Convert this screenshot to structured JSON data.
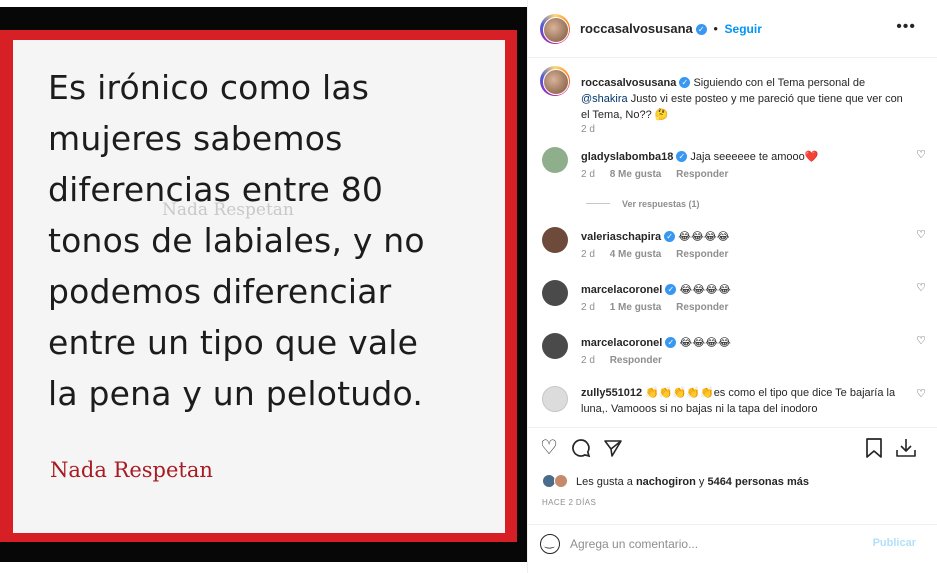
{
  "post_image": {
    "quote_lines": [
      "Es irónico como las",
      "mujeres sabemos",
      "diferencias entre 80",
      "tonos de labiales, y no",
      "podemos diferenciar",
      "entre un tipo que vale",
      "la pena y un pelotudo."
    ],
    "watermark": "Nada Respetan",
    "signature": "Nada Respetan"
  },
  "header": {
    "username": "roccasalvosusana",
    "separator": "•",
    "follow_label": "Seguir",
    "more_icon": "more-options-icon"
  },
  "caption": {
    "username": "roccasalvosusana",
    "text_before": " Siguiendo con el Tema personal de ",
    "mention": "@shakira",
    "text_after": " Justo vi este posteo y me pareció que tiene que ver con el Tema, No?? 🤔",
    "time": "2 d"
  },
  "comments": [
    {
      "username": "gladyslabomba18",
      "verified": true,
      "text": " Jaja seeeeee te amooo❤️",
      "time": "2 d",
      "likes": "8 Me gusta",
      "reply": "Responder",
      "avatar_color": "#8fae8b"
    },
    {
      "username": "valeriaschapira",
      "verified": true,
      "text": " 😂😂😂😂",
      "time": "2 d",
      "likes": "4 Me gusta",
      "reply": "Responder",
      "avatar_color": "#6e4a3a"
    },
    {
      "username": "marcelacoronel",
      "verified": true,
      "text": " 😂😂😂😂",
      "time": "2 d",
      "likes": "1 Me gusta",
      "reply": "Responder",
      "avatar_color": "#4a4a4a"
    },
    {
      "username": "marcelacoronel",
      "verified": true,
      "text": " 😂😂😂😂",
      "time": "2 d",
      "likes": "",
      "reply": "Responder",
      "avatar_color": "#4a4a4a"
    },
    {
      "username": "zully551012",
      "verified": false,
      "text": " 👏👏👏👏👏es como el tipo que dice Te bajaría la luna,. Vamooos si no bajas ni la tapa del inodoro",
      "time": "",
      "likes": "",
      "reply": "",
      "avatar_color": "#dcdcdc"
    }
  ],
  "view_replies": "Ver respuestas (1)",
  "actions": {
    "like_icon": "heart-icon",
    "comment_icon": "comment-icon",
    "share_icon": "share-icon",
    "save_icon": "bookmark-icon",
    "download_icon": "download-icon"
  },
  "likes": {
    "prefix": "Les gusta a ",
    "user": "nachogiron",
    "middle": " y ",
    "count": "5464 personas más"
  },
  "time_ago": "HACE 2 DÍAS",
  "add_comment": {
    "placeholder": "Agrega un comentario...",
    "publish_label": "Publicar"
  },
  "colors": {
    "red_border": "#d71f26",
    "signature": "#a71c22",
    "link_blue": "#0095f6",
    "publish_disabled": "#b2dffc"
  }
}
